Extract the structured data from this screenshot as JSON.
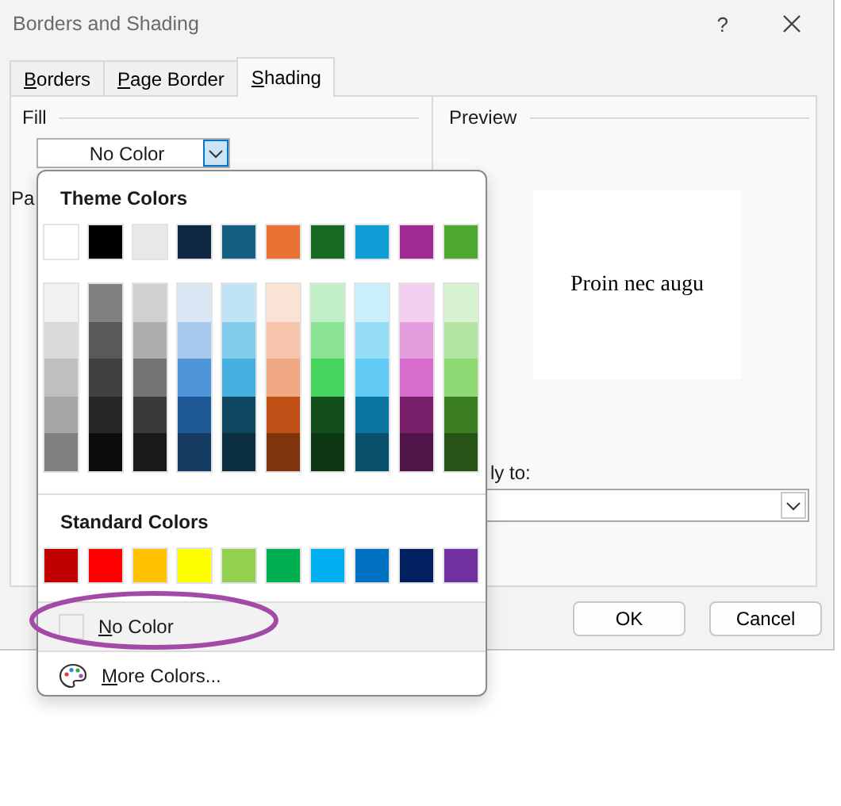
{
  "window": {
    "title": "Borders and Shading",
    "help": "?"
  },
  "tabs": [
    {
      "accel": "B",
      "rest": "orders",
      "selected": false
    },
    {
      "accel": "P",
      "rest": "age Border",
      "selected": false
    },
    {
      "accel": "S",
      "rest": "hading",
      "selected": true
    }
  ],
  "fill": {
    "legend": "Fill",
    "value": "No Color",
    "pattern_label": "Pa"
  },
  "preview": {
    "legend": "Preview",
    "sample": "Proin nec augu",
    "apply_label": "ly to:"
  },
  "buttons": [
    "OK",
    "Cancel"
  ],
  "color_menu": {
    "theme_heading": "Theme Colors",
    "theme_colors": [
      {
        "color": "#ffffff",
        "shades": [
          {
            "color": "#f2f2f2"
          },
          {
            "color": "#d9d9d9"
          },
          {
            "color": "#bfbfbf"
          },
          {
            "color": "#a6a6a6"
          },
          {
            "color": "#808080"
          }
        ]
      },
      {
        "color": "#000000",
        "shades": [
          {
            "color": "#808080"
          },
          {
            "color": "#595959"
          },
          {
            "color": "#404040"
          },
          {
            "color": "#262626"
          },
          {
            "color": "#0d0d0d"
          }
        ]
      },
      {
        "color": "#e8e8e8",
        "shades": [
          {
            "color": "#d0d0d0"
          },
          {
            "color": "#aeaeae"
          },
          {
            "color": "#757575"
          },
          {
            "color": "#3a3a3a"
          },
          {
            "color": "#1a1a1a"
          }
        ]
      },
      {
        "color": "#0e2841",
        "shades": [
          {
            "color": "#dae6f4"
          },
          {
            "color": "#a6c8ec"
          },
          {
            "color": "#4f95d9"
          },
          {
            "color": "#1f5a96"
          },
          {
            "color": "#153b62"
          }
        ]
      },
      {
        "color": "#156082",
        "shades": [
          {
            "color": "#c0e4f5"
          },
          {
            "color": "#83cbeb"
          },
          {
            "color": "#46b1e1"
          },
          {
            "color": "#0f4761"
          },
          {
            "color": "#0b2f40"
          }
        ]
      },
      {
        "color": "#e97132",
        "shades": [
          {
            "color": "#fae2d5"
          },
          {
            "color": "#f6c5ac"
          },
          {
            "color": "#f1a983"
          },
          {
            "color": "#c04f15"
          },
          {
            "color": "#80340e"
          }
        ]
      },
      {
        "color": "#196b24",
        "shades": [
          {
            "color": "#c1f0c7"
          },
          {
            "color": "#8ae394"
          },
          {
            "color": "#46d55c"
          },
          {
            "color": "#124f1a"
          },
          {
            "color": "#0c3512"
          }
        ]
      },
      {
        "color": "#0f9ed5",
        "shades": [
          {
            "color": "#caeefb"
          },
          {
            "color": "#95ddf7"
          },
          {
            "color": "#61cbf3"
          },
          {
            "color": "#0b76a0"
          },
          {
            "color": "#074f6a"
          }
        ]
      },
      {
        "color": "#a02b93",
        "shades": [
          {
            "color": "#f2cfee"
          },
          {
            "color": "#e49edd"
          },
          {
            "color": "#d86dcd"
          },
          {
            "color": "#782069"
          },
          {
            "color": "#501549"
          }
        ]
      },
      {
        "color": "#4ea72e",
        "shades": [
          {
            "color": "#d9f2d0"
          },
          {
            "color": "#b4e5a2"
          },
          {
            "color": "#8ed973"
          },
          {
            "color": "#3a7d22"
          },
          {
            "color": "#275317"
          }
        ]
      }
    ],
    "standard_heading": "Standard Colors",
    "standard_colors": [
      {
        "color": "#c00000"
      },
      {
        "color": "#ff0000"
      },
      {
        "color": "#ffc000"
      },
      {
        "color": "#ffff00"
      },
      {
        "color": "#92d050"
      },
      {
        "color": "#00b050"
      },
      {
        "color": "#00b0f0"
      },
      {
        "color": "#0070c0"
      },
      {
        "color": "#002060"
      },
      {
        "color": "#7030a0"
      }
    ],
    "no_color": {
      "accel": "N",
      "rest": "o Color"
    },
    "more_colors": {
      "accel": "M",
      "rest": "ore Colors..."
    }
  }
}
